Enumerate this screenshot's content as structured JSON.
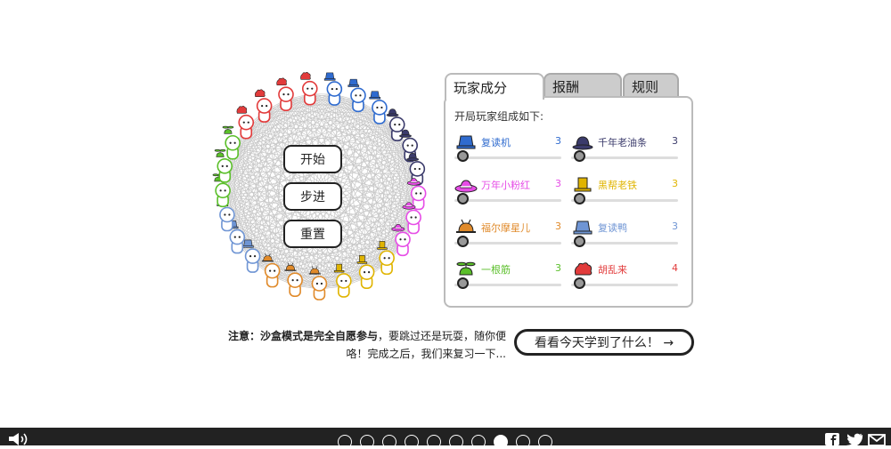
{
  "controls": {
    "start": "开始",
    "step": "步进",
    "reset": "重置"
  },
  "tabs": [
    {
      "label": "玩家成分",
      "active": true
    },
    {
      "label": "报酬",
      "active": false
    },
    {
      "label": "规则",
      "active": false
    }
  ],
  "panel": {
    "intro": "开局玩家组成如下:",
    "players": [
      {
        "name": "复读机",
        "count": "3",
        "color": "#2f6bcf",
        "hat": "blue-bucket-hat-icon"
      },
      {
        "name": "千年老油条",
        "count": "3",
        "color": "#3b3b6b",
        "hat": "bowler-hat-icon"
      },
      {
        "name": "万年小粉红",
        "count": "3",
        "color": "#e64ce6",
        "hat": "pink-sunhat-icon"
      },
      {
        "name": "黑帮老铁",
        "count": "3",
        "color": "#e0b400",
        "hat": "yellow-top-hat-icon"
      },
      {
        "name": "福尔摩星儿",
        "count": "3",
        "color": "#e08a2a",
        "hat": "deerstalker-hat-icon"
      },
      {
        "name": "复读鸭",
        "count": "3",
        "color": "#6f95d4",
        "hat": "light-blue-bucket-hat-icon"
      },
      {
        "name": "一根筋",
        "count": "3",
        "color": "#5bbf2a",
        "hat": "propeller-cap-icon"
      },
      {
        "name": "胡乱来",
        "count": "4",
        "color": "#e23b3b",
        "hat": "red-hair-icon"
      }
    ]
  },
  "note": {
    "bold": "注意：沙盒模式是完全自愿参与",
    "rest": "，要跳过还是玩耍，随你便咯！完成之后，我们来复习一下..."
  },
  "next_button": "看看今天学到了什么！ →",
  "pagination": {
    "total": 10,
    "current": 8
  },
  "icons": {
    "sound": "speaker-icon",
    "share": [
      "facebook-icon",
      "twitter-icon",
      "email-icon"
    ]
  }
}
